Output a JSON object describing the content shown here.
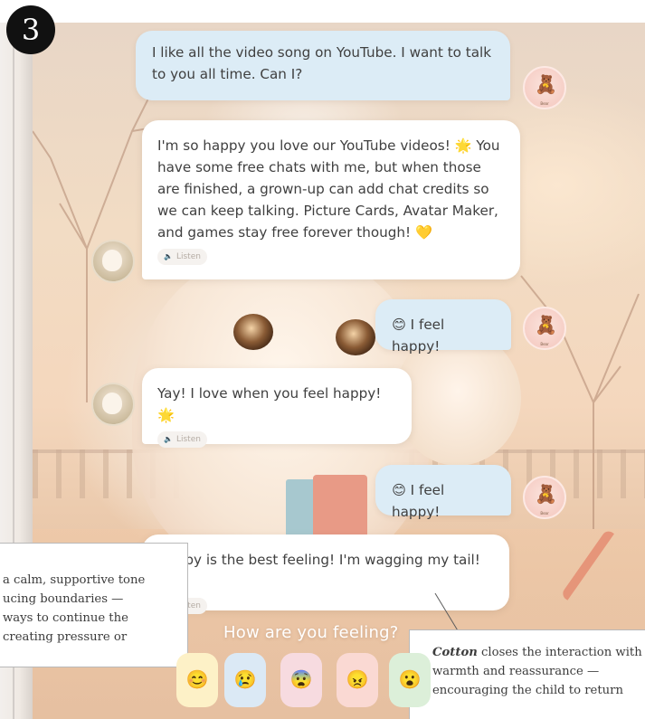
{
  "step_badge": "3",
  "conversation": {
    "messages": [
      {
        "role": "user",
        "text": "I like all the video song on YouTube. I want to talk to you all time. Can I?"
      },
      {
        "role": "bot",
        "text": "I'm so happy you love our YouTube videos! 🌟 You have some free chats with me, but when those are finished, a grown-up can add chat credits so we can keep talking. Picture Cards, Avatar Maker, and games stay free forever though! 💛",
        "listen": "Listen"
      },
      {
        "role": "user",
        "text": "😊 I feel happy!"
      },
      {
        "role": "bot",
        "text": "Yay! I love when you feel happy! 🌟",
        "listen": "Listen"
      },
      {
        "role": "user",
        "text": "😊 I feel happy!"
      },
      {
        "role": "bot",
        "text": "Happy is the best feeling! I'm wagging my tail! ✨",
        "listen": "Listen"
      }
    ]
  },
  "user_avatar_label": "Bear",
  "mood_prompt": "How are you feeling?",
  "moods": [
    {
      "emoji": "😊",
      "bg": "#fdf1c7"
    },
    {
      "emoji": "😢",
      "bg": "#dbe9f5"
    },
    {
      "emoji": "😨",
      "bg": "#f7dbe0"
    },
    {
      "emoji": "😠",
      "bg": "#fad9d3"
    },
    {
      "emoji": "😮",
      "bg": "#dcefd9"
    }
  ],
  "callouts": {
    "left": {
      "lines": [
        "a calm, supportive tone",
        "ucing boundaries —",
        "ways to continue the",
        "creating pressure or"
      ]
    },
    "right": {
      "lead": "Cotton",
      "rest": " closes the interaction with warmth and reassurance — encouraging the child to return"
    }
  },
  "colors": {
    "user_bubble": "#dcecf6",
    "bot_bubble": "#ffffff",
    "badge": "#111111"
  }
}
